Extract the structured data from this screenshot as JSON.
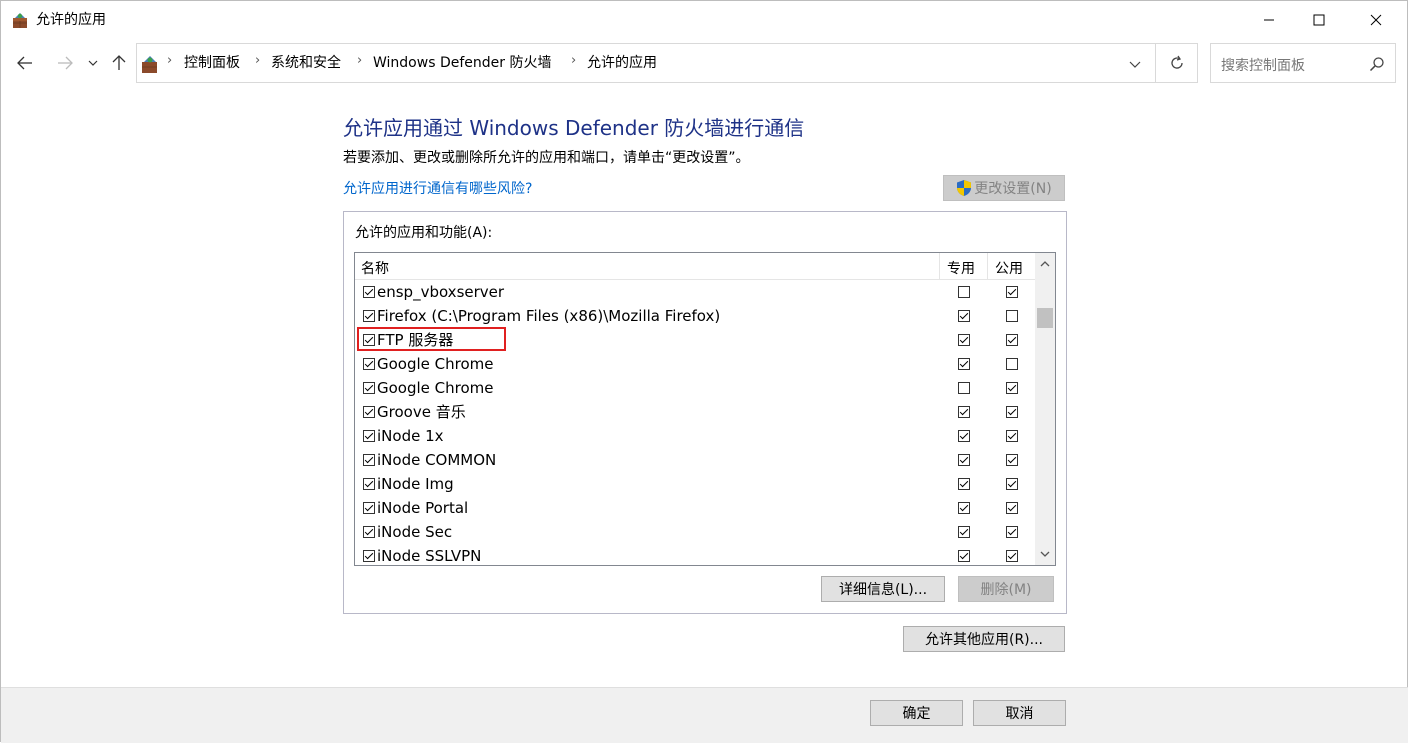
{
  "window": {
    "title": "允许的应用"
  },
  "address": {
    "crumbs": [
      "控制面板",
      "系统和安全",
      "Windows Defender 防火墙",
      "允许的应用"
    ]
  },
  "search": {
    "placeholder": "搜索控制面板"
  },
  "main": {
    "heading": "允许应用通过 Windows Defender 防火墙进行通信",
    "description": "若要添加、更改或删除所允许的应用和端口，请单击“更改设置”。",
    "risk_link": "允许应用进行通信有哪些风险?",
    "change_settings_label": "更改设置(N)"
  },
  "apps": {
    "group_label": "允许的应用和功能(A):",
    "columns": [
      "名称",
      "专用",
      "公用"
    ],
    "rows": [
      {
        "name": "ensp_vboxserver",
        "enabled": true,
        "private": false,
        "public": true
      },
      {
        "name": "Firefox (C:\\Program Files (x86)\\Mozilla Firefox)",
        "enabled": true,
        "private": true,
        "public": false
      },
      {
        "name": "FTP 服务器",
        "enabled": true,
        "private": true,
        "public": true
      },
      {
        "name": "Google Chrome",
        "enabled": true,
        "private": true,
        "public": false
      },
      {
        "name": "Google Chrome",
        "enabled": true,
        "private": false,
        "public": true
      },
      {
        "name": "Groove 音乐",
        "enabled": true,
        "private": true,
        "public": true
      },
      {
        "name": "iNode 1x",
        "enabled": true,
        "private": true,
        "public": true
      },
      {
        "name": "iNode COMMON",
        "enabled": true,
        "private": true,
        "public": true
      },
      {
        "name": "iNode Img",
        "enabled": true,
        "private": true,
        "public": true
      },
      {
        "name": "iNode Portal",
        "enabled": true,
        "private": true,
        "public": true
      },
      {
        "name": "iNode Sec",
        "enabled": true,
        "private": true,
        "public": true
      },
      {
        "name": "iNode SSLVPN",
        "enabled": true,
        "private": true,
        "public": true
      }
    ],
    "details_label": "详细信息(L)...",
    "delete_label": "删除(M)"
  },
  "allow_other_label": "允许其他应用(R)...",
  "footer": {
    "ok_label": "确定",
    "cancel_label": "取消"
  },
  "colors": {
    "heading": "#1e3287",
    "link": "#0066cc",
    "highlight": "#e02020"
  }
}
